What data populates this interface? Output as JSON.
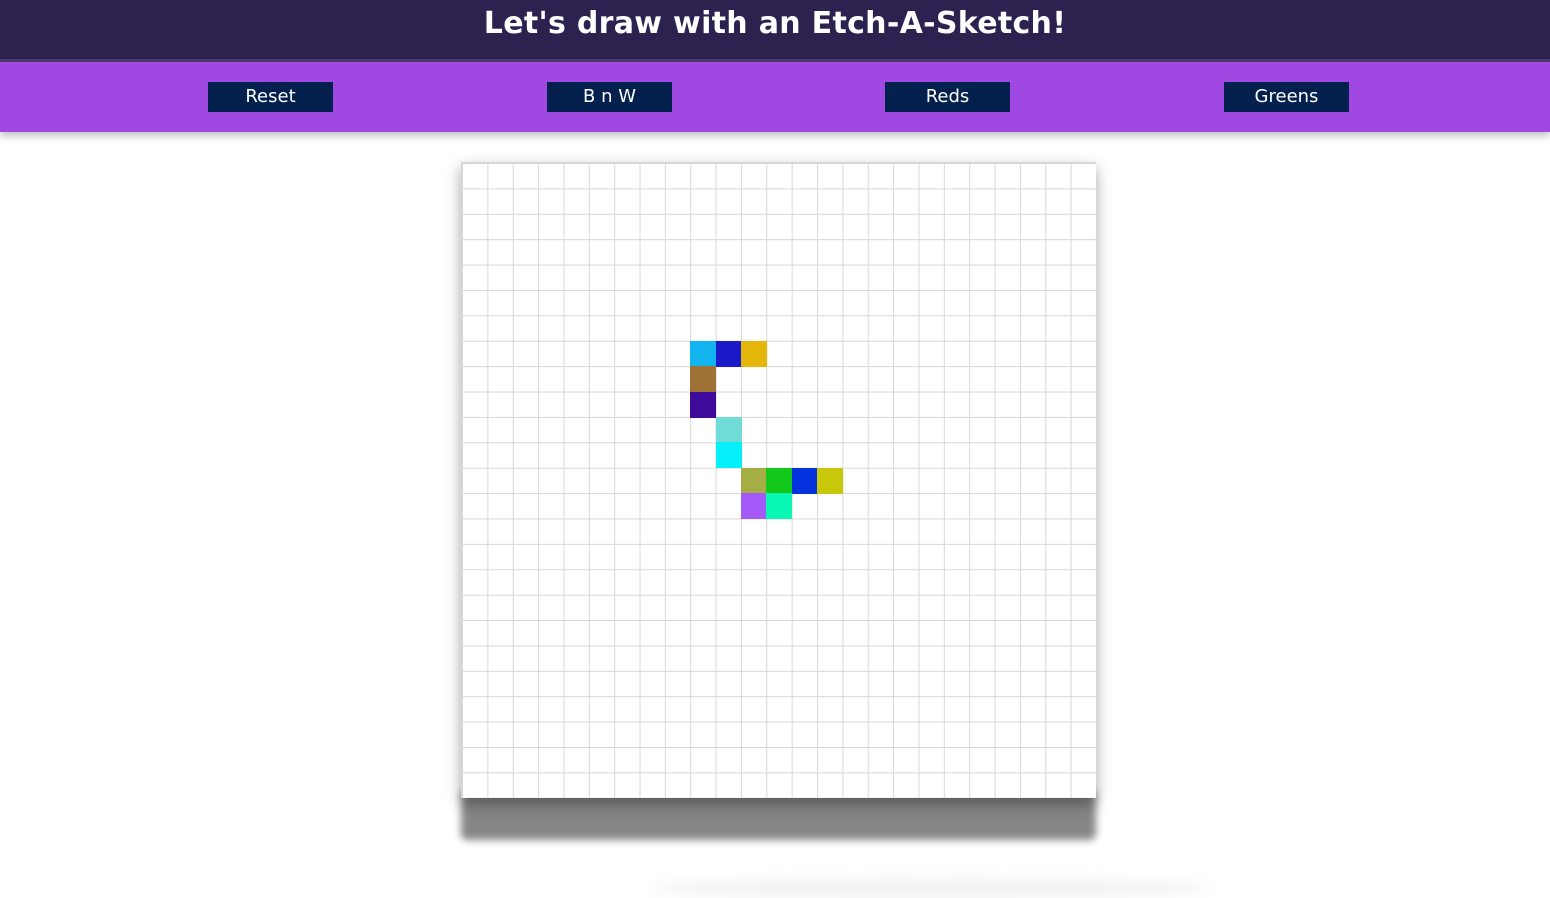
{
  "header": {
    "title": "Let's draw with an Etch-A-Sketch!"
  },
  "toolbar": {
    "buttons": [
      {
        "label": "Reset"
      },
      {
        "label": "B n W"
      },
      {
        "label": "Reds"
      },
      {
        "label": "Greens"
      }
    ]
  },
  "colors": {
    "header_bg": "#2d2150",
    "toolbar_bg": "#9f48e2",
    "button_bg": "#04204f"
  },
  "board": {
    "grid_columns": 25,
    "grid_rows": 25,
    "painted_cells": [
      {
        "col": 9,
        "row": 7,
        "color": "#12b4f0"
      },
      {
        "col": 10,
        "row": 7,
        "color": "#1a1ac8"
      },
      {
        "col": 11,
        "row": 7,
        "color": "#e4b60a"
      },
      {
        "col": 9,
        "row": 8,
        "color": "#9d7234"
      },
      {
        "col": 9,
        "row": 9,
        "color": "#3d0a9c"
      },
      {
        "col": 10,
        "row": 10,
        "color": "#6fdcd8"
      },
      {
        "col": 10,
        "row": 11,
        "color": "#05f0f8"
      },
      {
        "col": 11,
        "row": 12,
        "color": "#a4ae44"
      },
      {
        "col": 12,
        "row": 12,
        "color": "#12c81a"
      },
      {
        "col": 13,
        "row": 12,
        "color": "#0432dc"
      },
      {
        "col": 14,
        "row": 12,
        "color": "#c8c80a"
      },
      {
        "col": 11,
        "row": 13,
        "color": "#a45af6"
      },
      {
        "col": 12,
        "row": 13,
        "color": "#08f8b4"
      }
    ]
  }
}
